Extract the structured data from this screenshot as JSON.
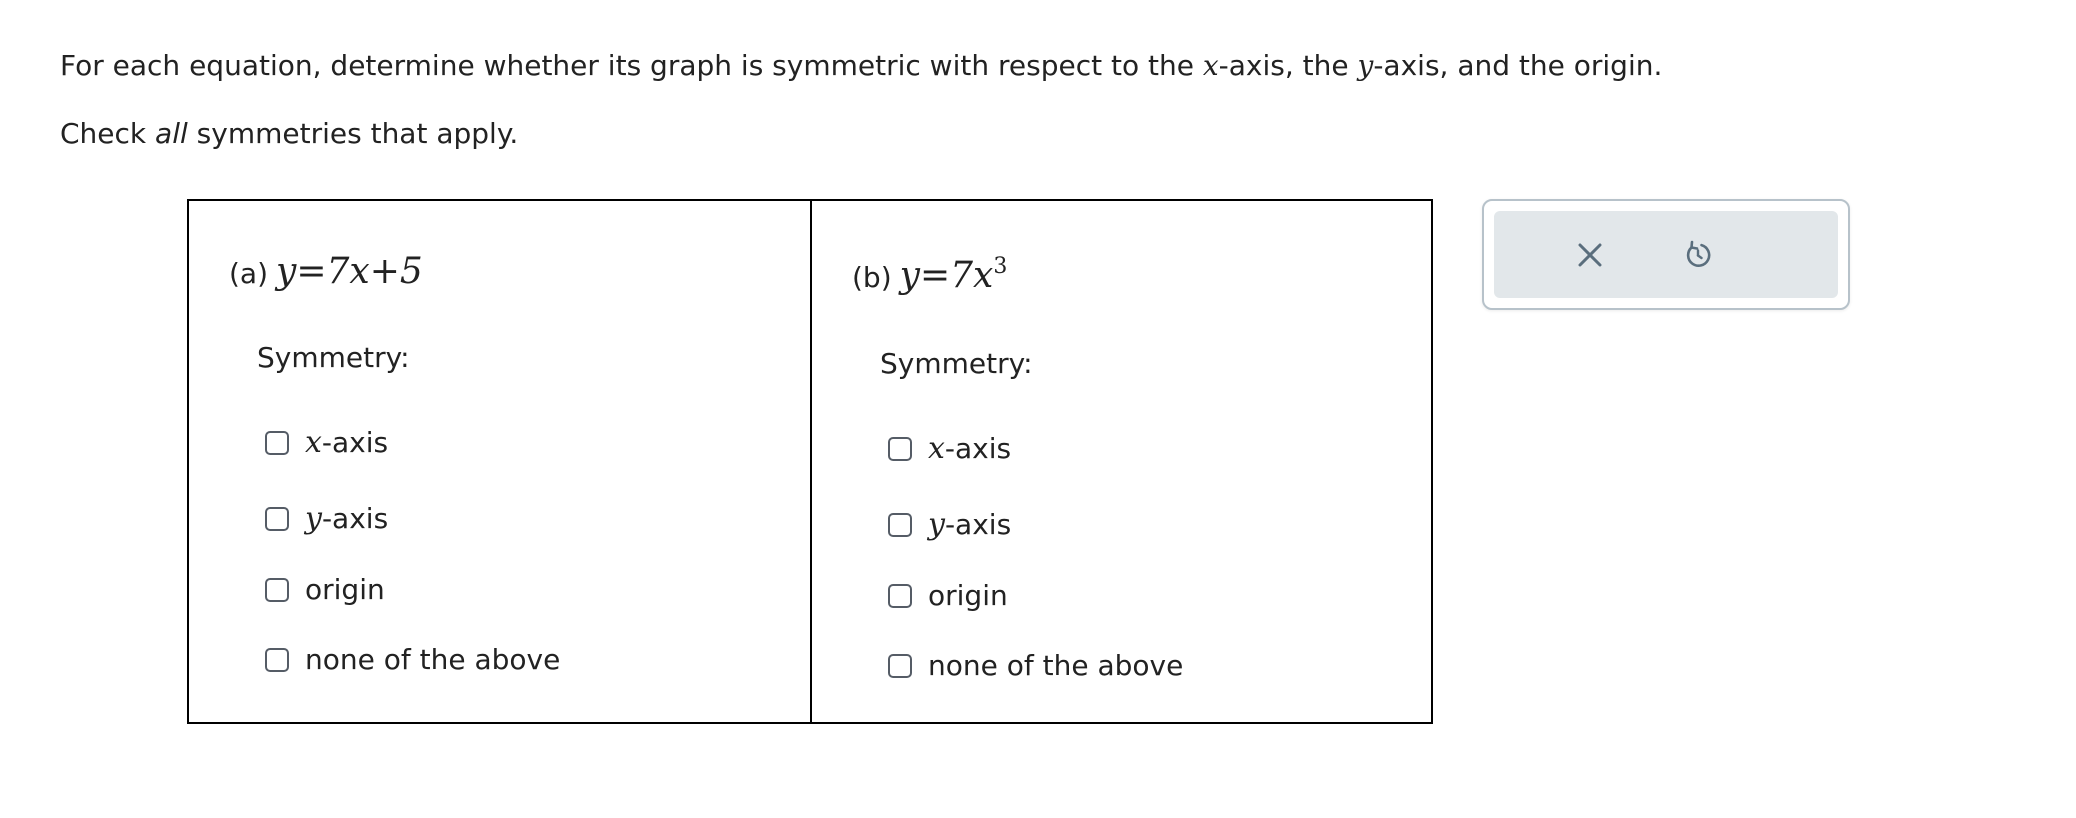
{
  "instructions": {
    "line1_before": "For each equation, determine whether its graph is symmetric with respect to the ",
    "x_var": "x",
    "line1_middle1": "-axis, the ",
    "y_var": "y",
    "line1_middle2": "-axis, and the origin.",
    "line2_before": "Check ",
    "line2_em": "all",
    "line2_after": " symmetries that apply."
  },
  "parts": [
    {
      "label": "(a)",
      "equation": "y=7x+5",
      "exponent": "",
      "symmetry_label": "Symmetry:",
      "options": [
        {
          "var": "x",
          "text": "-axis",
          "checked": false
        },
        {
          "var": "y",
          "text": "-axis",
          "checked": false
        },
        {
          "var": "",
          "text": "origin",
          "checked": false
        },
        {
          "var": "",
          "text": "none of the above",
          "checked": false
        }
      ]
    },
    {
      "label": "(b)",
      "equation": "y=7x",
      "exponent": "3",
      "symmetry_label": "Symmetry:",
      "options": [
        {
          "var": "x",
          "text": "-axis",
          "checked": false
        },
        {
          "var": "y",
          "text": "-axis",
          "checked": false
        },
        {
          "var": "",
          "text": "origin",
          "checked": false
        },
        {
          "var": "",
          "text": "none of the above",
          "checked": false
        }
      ]
    }
  ],
  "controls": {
    "clear_icon": "close-icon",
    "undo_icon": "undo-icon",
    "icon_color": "#5a6e7d"
  }
}
